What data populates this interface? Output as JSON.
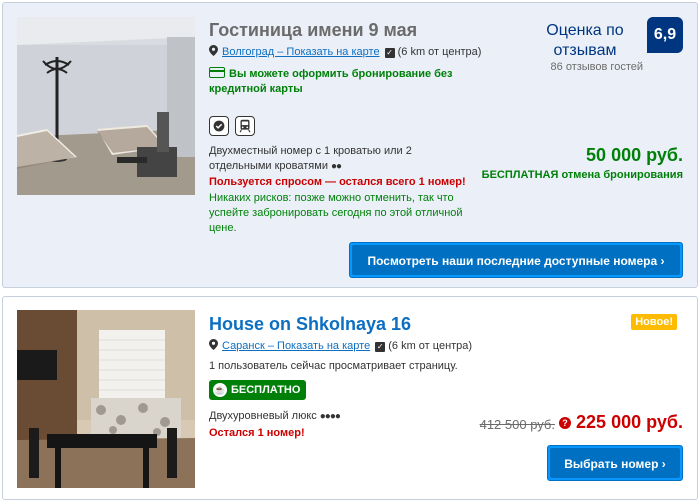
{
  "hotels": [
    {
      "name": "Гостиница имени 9 мая",
      "city_link": "Волгоград – Показать на карте",
      "distance": "(6 km от центра)",
      "no_credit_card": "Вы можете оформить бронирование без кредитной карты",
      "room_type": "Двухместный номер с 1 кроватью или 2 отдельными кроватями",
      "scarcity": "Пользуется спросом — остался всего 1 номер!",
      "no_risk": "Никаких рисков: позже можно отменить, так что успейте забронировать сегодня по этой отличной цене.",
      "score_label": "Оценка по отзывам",
      "score": "6,9",
      "reviews_count": "86 отзывов гостей",
      "price": "50 000 руб.",
      "free_cancel": "БЕСПЛАТНАЯ отмена бронирования",
      "button": "Посмотреть наши последние доступные номера ›",
      "amenity_icons": [
        "verified-icon",
        "train-icon"
      ]
    },
    {
      "name": "House on Shkolnaya 16",
      "badge": "Новое!",
      "city_link": "Саранск – Показать на карте",
      "distance": "(6 km от центра)",
      "viewing": "1 пользователь сейчас просматривает страницу.",
      "free_badge": "БЕСПЛАТНО",
      "room_type": "Двухуровневый люкс",
      "scarcity": "Остался 1 номер!",
      "old_price": "412 500 руб.",
      "price": "225 000 руб.",
      "button": "Выбрать номер ›"
    }
  ],
  "colors": {
    "brand_blue": "#003580",
    "link_blue": "#0c6fc2",
    "green": "#008009",
    "red": "#cc0000",
    "badge_yellow": "#febb02"
  }
}
